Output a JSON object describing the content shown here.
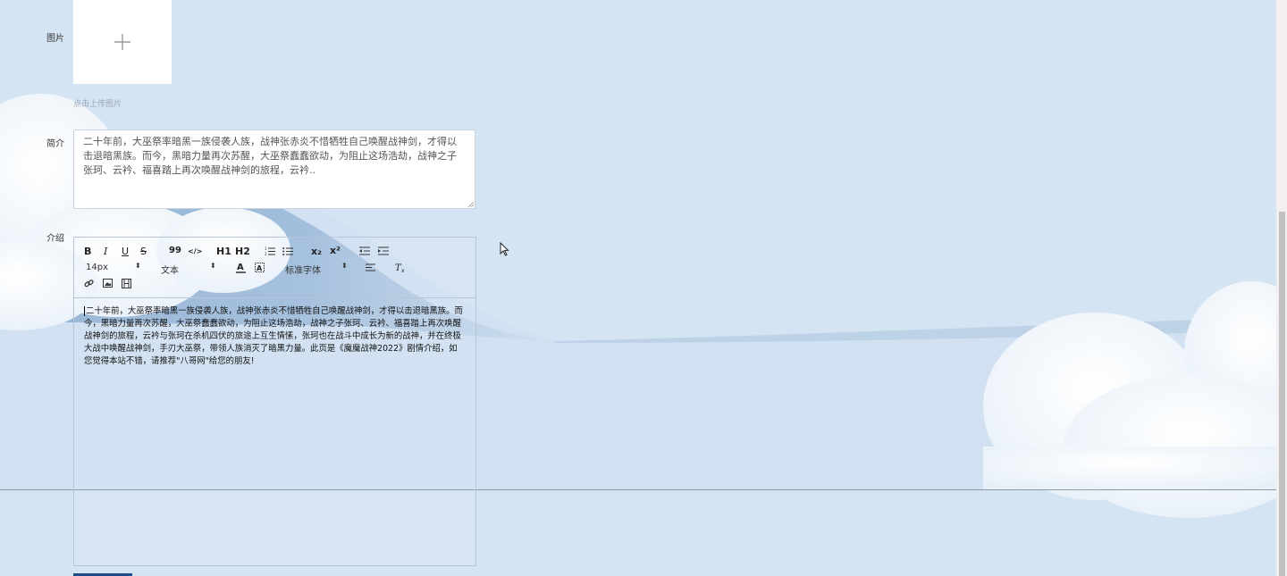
{
  "form": {
    "image_label": "图片",
    "upload_hint": "点击上传图片",
    "summary_label": "简介",
    "summary_text": "二十年前，大巫祭率暗黑一族侵袭人族，战神张赤炎不惜牺牲自己唤醒战神剑，才得以击退暗黑族。而今，黑暗力量再次苏醒，大巫祭蠢蠢欲动，为阻止这场浩劫，战神之子张珂、云衿、福喜踏上再次唤醒战神剑的旅程，云衿..",
    "intro_label": "介绍"
  },
  "editor": {
    "toolbar": {
      "bold": "B",
      "italic": "I",
      "underline": "U",
      "strike": "S",
      "blockquote": "99",
      "code": "</>",
      "h1": "H1",
      "h2": "H2",
      "subscript": "x₂",
      "superscript": "x²",
      "font_size": "14px",
      "heading_type": "文本",
      "font_family": "标准字体"
    },
    "content": "二十年前，大巫祭率暗黑一族侵袭人族，战神张赤炎不惜牺牲自己唤醒战神剑，才得以击退暗黑族。而今，黑暗力量再次苏醒，大巫祭蠢蠢欲动，为阻止这场浩劫，战神之子张珂、云衿、福喜踏上再次唤醒战神剑的旅程，云衿与张珂在杀机四伏的旅途上互生情愫，张珂也在战斗中成长为新的战神，并在终极大战中唤醒战神剑，手刃大巫祭，带领人族消灭了暗黑力量。此页是《魔魔战神2022》剧情介绍，如您觉得本站不错，请推荐\"八哥网\"给您的朋友!"
  },
  "icons": {
    "upload": "plus-icon",
    "link": "link-icon",
    "image": "image-icon",
    "video": "video-icon"
  }
}
